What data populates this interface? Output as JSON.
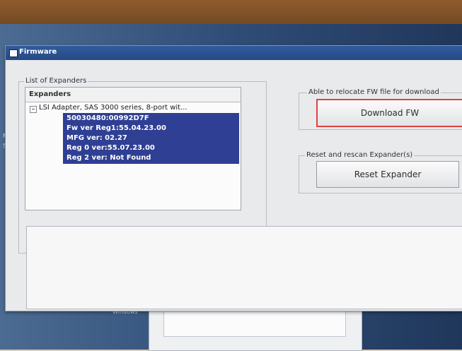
{
  "desktop": {
    "labels": [
      "Ma",
      "St"
    ],
    "background_label": "Windows"
  },
  "window": {
    "title": "Firmware"
  },
  "left_group": {
    "title": "List of Expanders",
    "header": "Expanders",
    "root_item": "LSI Adapter, SAS 3000 series, 8-port wit...",
    "details": [
      "50030480:00992D7F",
      "Fw ver Reg1:55.04.23.00",
      "MFG ver: 02.27",
      "Reg 0 ver:55.07.23.00",
      "Reg 2 ver: Not Found"
    ]
  },
  "right_group_1": {
    "title": "Able to relocate FW file for download",
    "button": "Download FW"
  },
  "right_group_2": {
    "title": "Reset and rescan Expander(s)",
    "button": "Reset Expander"
  },
  "colors": {
    "selected_background": "#2f3f94",
    "title_bar": "#315b9d",
    "highlight_border": "#e04141"
  },
  "icons": {
    "window": "window-icon",
    "expand": "collapse-box-icon",
    "cursor": "arrow-cursor-icon"
  }
}
